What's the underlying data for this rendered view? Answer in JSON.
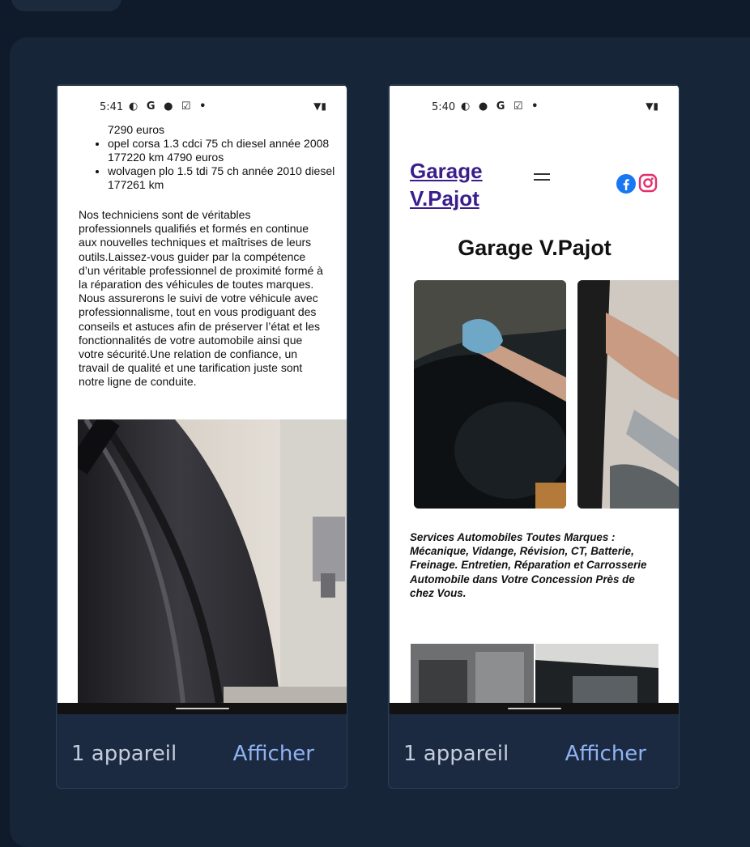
{
  "cards": [
    {
      "status_time": "5:41",
      "status_icons": "◐ G ● ☑ •",
      "list_first": "7290 euros",
      "list_items": [
        "opel corsa 1.3 cdci 75 ch diesel année 2008 177220 km 4790 euros",
        "wolvagen plo 1.5 tdi 75 ch année 2010 diesel 177261 km"
      ],
      "paragraph": "Nos techniciens sont de véritables professionnels qualifiés et formés en continue aux nouvelles techniques et maîtrises de leurs outils.Laissez-vous guider par la compétence d’un véritable professionnel de proximité formé à la réparation des véhicules de toutes marques. Nous assurerons le suivi de votre véhicule avec professionnalisme, tout en vous prodiguant des conseils et astuces afin de préserver l’état et les fonctionnalités de votre automobile ainsi que votre sécurité.Une relation de confiance, un travail de qualité et une tarification juste sont notre ligne de conduite.",
      "count_label": "1 appareil",
      "action_label": "Afficher"
    },
    {
      "status_time": "5:40",
      "status_icons": "◐ ● G ☑ •",
      "brand_line1": "Garage",
      "brand_line2": "V.Pajot",
      "page_title": "Garage V.Pajot",
      "services": "Services Automobiles Toutes Marques : Mécanique, Vidange, Révision, CT, Batterie, Freinage. Entretien, Réparation et Carrosserie Automobile dans Votre Concession Près de chez Vous.",
      "count_label": "1 appareil",
      "action_label": "Afficher"
    }
  ],
  "icons": {
    "status_system": "wifi-icon battery-icon",
    "menu": "hamburger-menu-icon",
    "social": [
      "facebook-icon",
      "instagram-icon"
    ]
  },
  "colors": {
    "page_bg": "#0f1b2b",
    "panel_bg": "#172538",
    "card_bg": "#1b2a40",
    "action_text": "#8fb3f2",
    "brand_link": "#3b1e8a"
  }
}
